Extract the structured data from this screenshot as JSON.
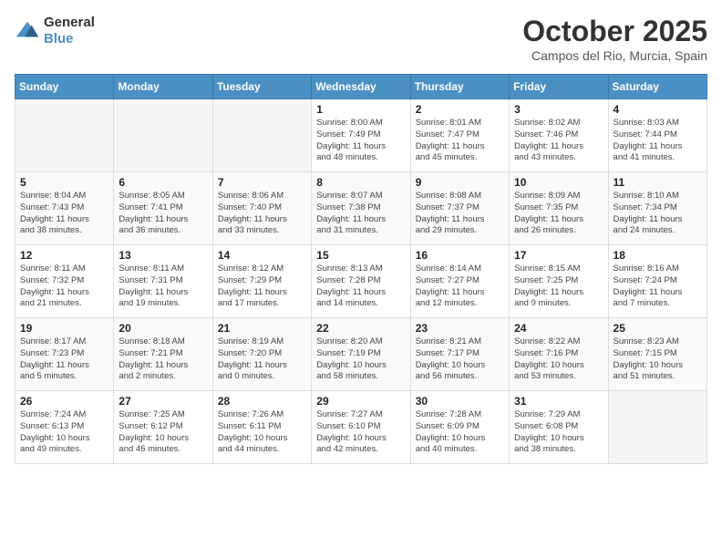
{
  "header": {
    "logo_line1": "General",
    "logo_line2": "Blue",
    "month": "October 2025",
    "location": "Campos del Rio, Murcia, Spain"
  },
  "weekdays": [
    "Sunday",
    "Monday",
    "Tuesday",
    "Wednesday",
    "Thursday",
    "Friday",
    "Saturday"
  ],
  "weeks": [
    [
      {
        "day": "",
        "info": ""
      },
      {
        "day": "",
        "info": ""
      },
      {
        "day": "",
        "info": ""
      },
      {
        "day": "1",
        "info": "Sunrise: 8:00 AM\nSunset: 7:49 PM\nDaylight: 11 hours\nand 48 minutes."
      },
      {
        "day": "2",
        "info": "Sunrise: 8:01 AM\nSunset: 7:47 PM\nDaylight: 11 hours\nand 45 minutes."
      },
      {
        "day": "3",
        "info": "Sunrise: 8:02 AM\nSunset: 7:46 PM\nDaylight: 11 hours\nand 43 minutes."
      },
      {
        "day": "4",
        "info": "Sunrise: 8:03 AM\nSunset: 7:44 PM\nDaylight: 11 hours\nand 41 minutes."
      }
    ],
    [
      {
        "day": "5",
        "info": "Sunrise: 8:04 AM\nSunset: 7:43 PM\nDaylight: 11 hours\nand 38 minutes."
      },
      {
        "day": "6",
        "info": "Sunrise: 8:05 AM\nSunset: 7:41 PM\nDaylight: 11 hours\nand 36 minutes."
      },
      {
        "day": "7",
        "info": "Sunrise: 8:06 AM\nSunset: 7:40 PM\nDaylight: 11 hours\nand 33 minutes."
      },
      {
        "day": "8",
        "info": "Sunrise: 8:07 AM\nSunset: 7:38 PM\nDaylight: 11 hours\nand 31 minutes."
      },
      {
        "day": "9",
        "info": "Sunrise: 8:08 AM\nSunset: 7:37 PM\nDaylight: 11 hours\nand 29 minutes."
      },
      {
        "day": "10",
        "info": "Sunrise: 8:09 AM\nSunset: 7:35 PM\nDaylight: 11 hours\nand 26 minutes."
      },
      {
        "day": "11",
        "info": "Sunrise: 8:10 AM\nSunset: 7:34 PM\nDaylight: 11 hours\nand 24 minutes."
      }
    ],
    [
      {
        "day": "12",
        "info": "Sunrise: 8:11 AM\nSunset: 7:32 PM\nDaylight: 11 hours\nand 21 minutes."
      },
      {
        "day": "13",
        "info": "Sunrise: 8:11 AM\nSunset: 7:31 PM\nDaylight: 11 hours\nand 19 minutes."
      },
      {
        "day": "14",
        "info": "Sunrise: 8:12 AM\nSunset: 7:29 PM\nDaylight: 11 hours\nand 17 minutes."
      },
      {
        "day": "15",
        "info": "Sunrise: 8:13 AM\nSunset: 7:28 PM\nDaylight: 11 hours\nand 14 minutes."
      },
      {
        "day": "16",
        "info": "Sunrise: 8:14 AM\nSunset: 7:27 PM\nDaylight: 11 hours\nand 12 minutes."
      },
      {
        "day": "17",
        "info": "Sunrise: 8:15 AM\nSunset: 7:25 PM\nDaylight: 11 hours\nand 9 minutes."
      },
      {
        "day": "18",
        "info": "Sunrise: 8:16 AM\nSunset: 7:24 PM\nDaylight: 11 hours\nand 7 minutes."
      }
    ],
    [
      {
        "day": "19",
        "info": "Sunrise: 8:17 AM\nSunset: 7:23 PM\nDaylight: 11 hours\nand 5 minutes."
      },
      {
        "day": "20",
        "info": "Sunrise: 8:18 AM\nSunset: 7:21 PM\nDaylight: 11 hours\nand 2 minutes."
      },
      {
        "day": "21",
        "info": "Sunrise: 8:19 AM\nSunset: 7:20 PM\nDaylight: 11 hours\nand 0 minutes."
      },
      {
        "day": "22",
        "info": "Sunrise: 8:20 AM\nSunset: 7:19 PM\nDaylight: 10 hours\nand 58 minutes."
      },
      {
        "day": "23",
        "info": "Sunrise: 8:21 AM\nSunset: 7:17 PM\nDaylight: 10 hours\nand 56 minutes."
      },
      {
        "day": "24",
        "info": "Sunrise: 8:22 AM\nSunset: 7:16 PM\nDaylight: 10 hours\nand 53 minutes."
      },
      {
        "day": "25",
        "info": "Sunrise: 8:23 AM\nSunset: 7:15 PM\nDaylight: 10 hours\nand 51 minutes."
      }
    ],
    [
      {
        "day": "26",
        "info": "Sunrise: 7:24 AM\nSunset: 6:13 PM\nDaylight: 10 hours\nand 49 minutes."
      },
      {
        "day": "27",
        "info": "Sunrise: 7:25 AM\nSunset: 6:12 PM\nDaylight: 10 hours\nand 46 minutes."
      },
      {
        "day": "28",
        "info": "Sunrise: 7:26 AM\nSunset: 6:11 PM\nDaylight: 10 hours\nand 44 minutes."
      },
      {
        "day": "29",
        "info": "Sunrise: 7:27 AM\nSunset: 6:10 PM\nDaylight: 10 hours\nand 42 minutes."
      },
      {
        "day": "30",
        "info": "Sunrise: 7:28 AM\nSunset: 6:09 PM\nDaylight: 10 hours\nand 40 minutes."
      },
      {
        "day": "31",
        "info": "Sunrise: 7:29 AM\nSunset: 6:08 PM\nDaylight: 10 hours\nand 38 minutes."
      },
      {
        "day": "",
        "info": ""
      }
    ]
  ]
}
